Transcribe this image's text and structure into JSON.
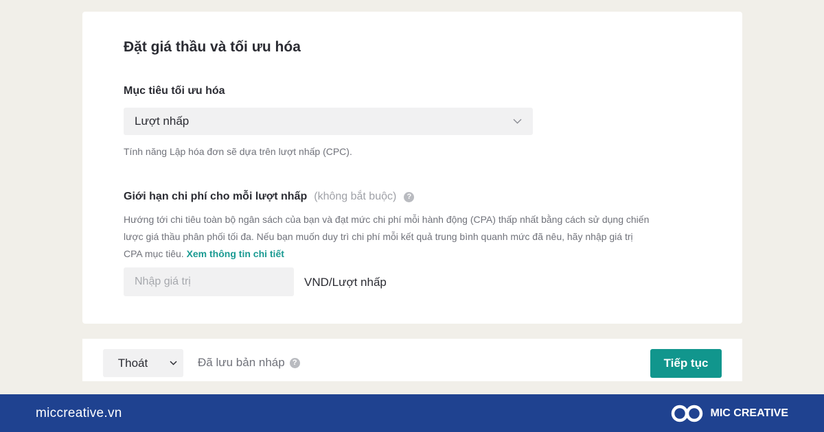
{
  "section": {
    "title": "Đặt giá thầu và tối ưu hóa"
  },
  "optimization": {
    "label": "Mục tiêu tối ưu hóa",
    "selected": "Lượt nhấp",
    "hint": "Tính năng Lập hóa đơn sẽ dựa trên lượt nhấp (CPC)."
  },
  "cost_cap": {
    "label": "Giới hạn chi phí cho mỗi lượt nhấp",
    "optional": "(không bắt buộc)",
    "help_icon": "question-circle-icon",
    "description_line1": "Hướng tới chi tiêu toàn bộ ngân sách của bạn và đạt mức chi phí mỗi hành động (CPA) thấp nhất bằng cách sử dụng chiến",
    "description_line2": "lược giá thầu phân phối tối đa. Nếu bạn muốn duy trì chi phí mỗi kết quả trung bình quanh mức đã nêu, hãy nhập giá trị",
    "description_line3": "CPA mục tiêu.",
    "link": "Xem thông tin chi tiết",
    "input_placeholder": "Nhập giá trị",
    "input_value": "",
    "unit": "VND/Lượt nhấp"
  },
  "footer": {
    "exit_label": "Thoát",
    "saved_label": "Đã lưu bản nháp",
    "continue_label": "Tiếp tục"
  },
  "brand": {
    "url": "miccreative.vn",
    "name": "MIC CREATIVE"
  },
  "colors": {
    "accent": "#11968d",
    "link": "#1a9a92",
    "brand_bar": "#1f4290"
  }
}
